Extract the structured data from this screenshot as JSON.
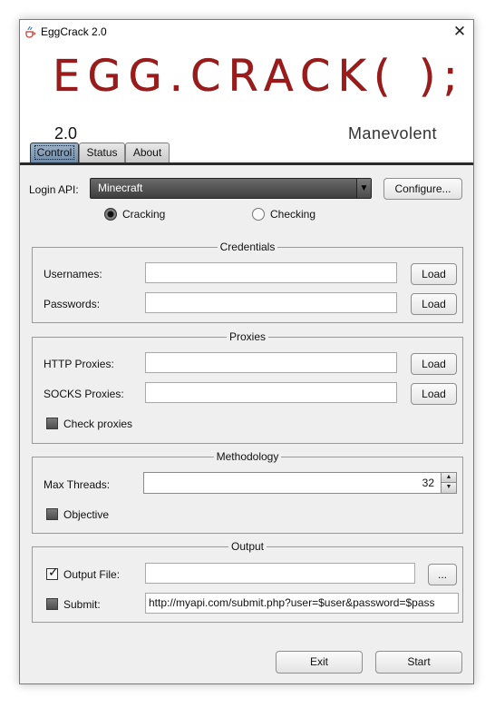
{
  "window": {
    "title": "EggCrack 2.0",
    "close_glyph": "✕"
  },
  "banner": {
    "logo": "EGG.CRACK( );",
    "version": "2.0",
    "author": "Manevolent"
  },
  "tabs": [
    {
      "label": "Control",
      "active": true
    },
    {
      "label": "Status",
      "active": false
    },
    {
      "label": "About",
      "active": false
    }
  ],
  "login": {
    "label": "Login API:",
    "selected": "Minecraft",
    "configure_label": "Configure..."
  },
  "mode": {
    "cracking": {
      "label": "Cracking",
      "selected": true
    },
    "checking": {
      "label": "Checking",
      "selected": false
    }
  },
  "credentials": {
    "title": "Credentials",
    "usernames_label": "Usernames:",
    "usernames_value": "",
    "passwords_label": "Passwords:",
    "passwords_value": "",
    "load_label": "Load"
  },
  "proxies": {
    "title": "Proxies",
    "http_label": "HTTP Proxies:",
    "http_value": "",
    "socks_label": "SOCKS Proxies:",
    "socks_value": "",
    "load_label": "Load",
    "check_label": "Check proxies",
    "check_checked": false
  },
  "methodology": {
    "title": "Methodology",
    "threads_label": "Max Threads:",
    "threads_value": "32",
    "objective_label": "Objective",
    "objective_checked": false
  },
  "output": {
    "title": "Output",
    "file_label": "Output File:",
    "file_checked": true,
    "file_value": "",
    "browse_label": "...",
    "submit_label": "Submit:",
    "submit_checked": false,
    "submit_value": "http://myapi.com/submit.php?user=$user&password=$pass"
  },
  "footer": {
    "exit_label": "Exit",
    "start_label": "Start"
  },
  "colors": {
    "logo": "#9b1a1a",
    "active_tab": "#7f9bb7",
    "tab_divider": "#2a2a2a"
  },
  "icons": {
    "app": "java-cup-icon",
    "combo_arrow": "▼",
    "spin_up": "▲",
    "spin_down": "▼"
  }
}
